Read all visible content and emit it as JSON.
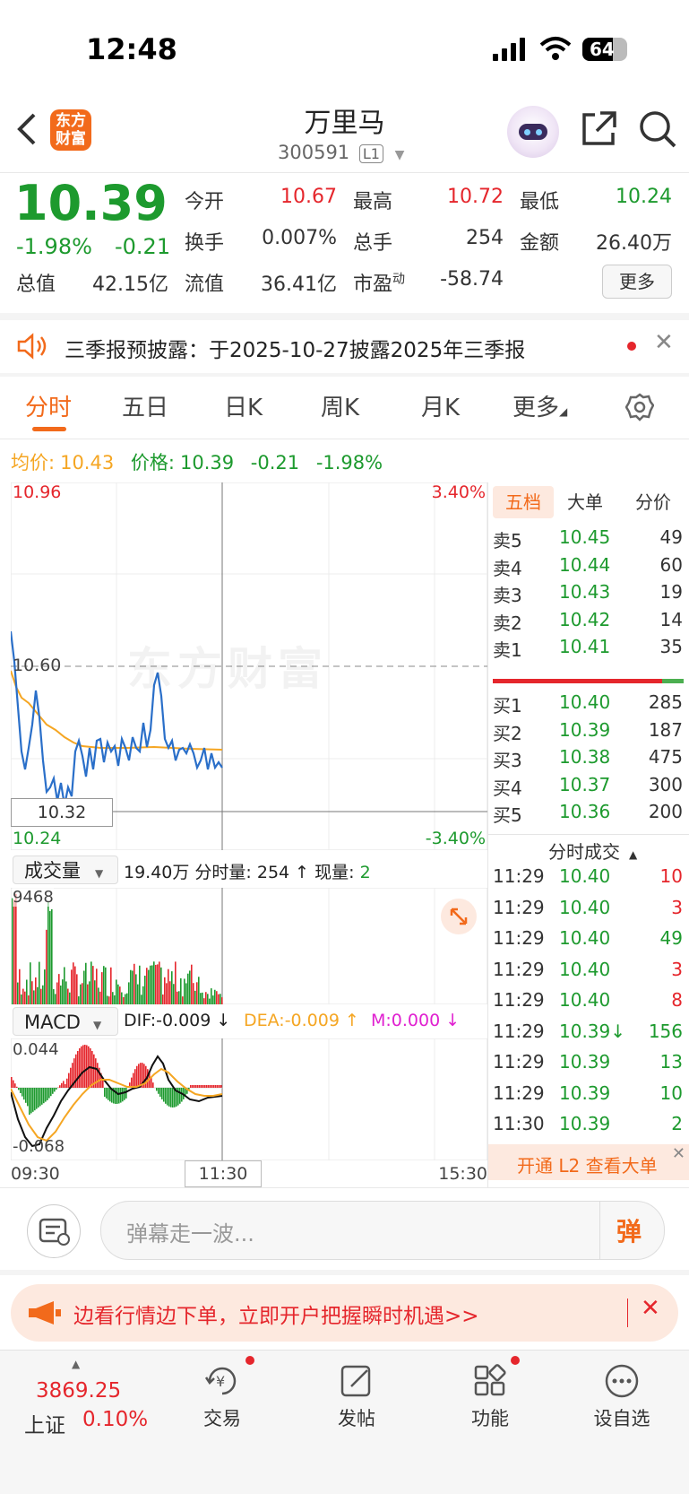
{
  "status_bar": {
    "time": "12:48",
    "battery": "64"
  },
  "header": {
    "logo_text_1": "东方",
    "logo_text_2": "财富",
    "stock_name": "万里马",
    "stock_code": "300591",
    "level_badge": "L1"
  },
  "quote": {
    "price": "10.39",
    "change_pct": "-1.98%",
    "change": "-0.21",
    "open_label": "今开",
    "open": "10.67",
    "high_label": "最高",
    "high": "10.72",
    "low_label": "最低",
    "low": "10.24",
    "turnover_label": "换手",
    "turnover": "0.007%",
    "volume_label": "总手",
    "volume": "254",
    "amount_label": "金额",
    "amount": "26.40万",
    "mktcap_label": "总值",
    "mktcap": "42.15亿",
    "float_label": "流值",
    "float": "36.41亿",
    "pe_label": "市盈",
    "pe_sup": "动",
    "pe": "-58.74",
    "more_button": "更多"
  },
  "notice": {
    "text": "三季报预披露：于2025-10-27披露2025年三季报"
  },
  "tabs": [
    "分时",
    "五日",
    "日K",
    "周K",
    "月K",
    "更多"
  ],
  "chart": {
    "avg_label": "均价:",
    "avg_value": "10.43",
    "price_label": "价格:",
    "price_value": "10.39",
    "price_change": "-0.21",
    "price_pct": "-1.98%",
    "y_top": "10.96",
    "y_mid": "10.60",
    "y_bottom": "10.24",
    "pct_top": "3.40%",
    "pct_bottom": "-3.40%",
    "cursor_price": "10.32",
    "watermark": "东方财富",
    "vol_selector": "成交量",
    "vol_info_1": "19.40万 分时量: 254 ↑ 现量: ",
    "vol_info_now": "2",
    "vol_max": "9468",
    "macd_selector": "MACD",
    "dif": "DIF:-0.009 ↓",
    "dea": "DEA:-0.009 ↑",
    "m": "M:0.000 ↓",
    "macd_top": "0.044",
    "macd_bottom": "-0.068",
    "time_start": "09:30",
    "time_mid": "11:30",
    "time_end": "15:30"
  },
  "order_book": {
    "tabs": [
      "五档",
      "大单",
      "分价"
    ],
    "asks": [
      {
        "label": "卖5",
        "price": "10.45",
        "vol": "49"
      },
      {
        "label": "卖4",
        "price": "10.44",
        "vol": "60"
      },
      {
        "label": "卖3",
        "price": "10.43",
        "vol": "19"
      },
      {
        "label": "卖2",
        "price": "10.42",
        "vol": "14"
      },
      {
        "label": "卖1",
        "price": "10.41",
        "vol": "35"
      }
    ],
    "bids": [
      {
        "label": "买1",
        "price": "10.40",
        "vol": "285"
      },
      {
        "label": "买2",
        "price": "10.39",
        "vol": "187"
      },
      {
        "label": "买3",
        "price": "10.38",
        "vol": "475"
      },
      {
        "label": "买4",
        "price": "10.37",
        "vol": "300"
      },
      {
        "label": "买5",
        "price": "10.36",
        "vol": "200"
      }
    ]
  },
  "ticks": {
    "title": "分时成交",
    "rows": [
      {
        "time": "11:29",
        "price": "10.40",
        "vol": "10",
        "color": "red"
      },
      {
        "time": "11:29",
        "price": "10.40",
        "vol": "3",
        "color": "red"
      },
      {
        "time": "11:29",
        "price": "10.40",
        "vol": "49",
        "color": "green"
      },
      {
        "time": "11:29",
        "price": "10.40",
        "vol": "3",
        "color": "red"
      },
      {
        "time": "11:29",
        "price": "10.40",
        "vol": "8",
        "color": "red"
      },
      {
        "time": "11:29",
        "price": "10.39↓",
        "vol": "156",
        "color": "green"
      },
      {
        "time": "11:29",
        "price": "10.39",
        "vol": "13",
        "color": "green"
      },
      {
        "time": "11:29",
        "price": "10.39",
        "vol": "10",
        "color": "green"
      },
      {
        "time": "11:30",
        "price": "10.39",
        "vol": "2",
        "color": "green"
      }
    ],
    "l2_promo": "开通 L2 查看大单"
  },
  "comment": {
    "placeholder": "弹幕走一波...",
    "send_label": "弹"
  },
  "banner": {
    "text": "边看行情边下单，立即开户把握瞬时机遇>>"
  },
  "bottom_nav": {
    "index_value": "3869.25",
    "index_name": "上证",
    "index_pct": "0.10%",
    "items": [
      "交易",
      "发帖",
      "功能",
      "设自选"
    ]
  },
  "colors": {
    "up": "#e5262c",
    "down": "#1d9a2e",
    "avg_line": "#f5a623",
    "price_line": "#2a6fc9",
    "accent": "#f26a1b"
  }
}
